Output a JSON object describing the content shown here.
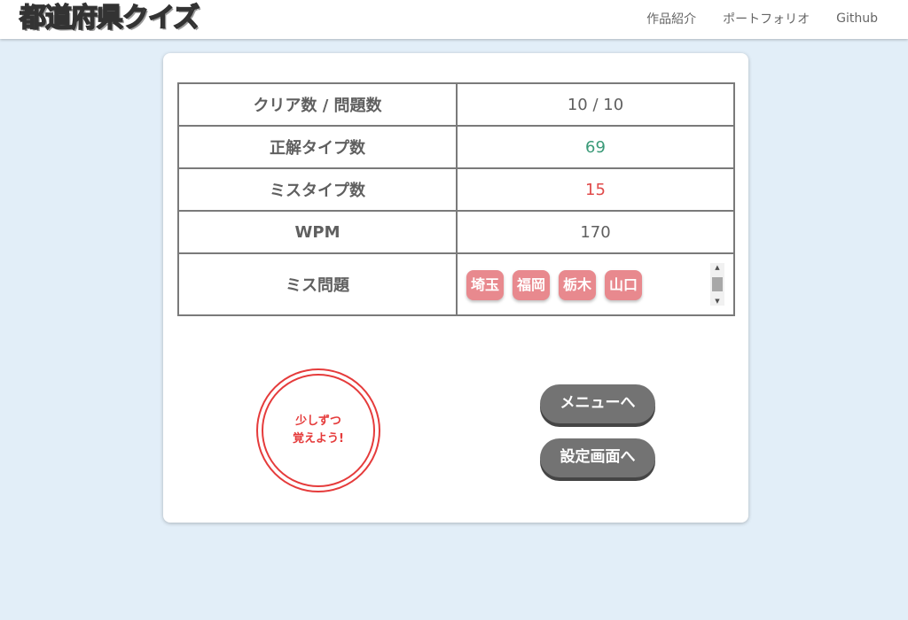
{
  "header": {
    "logo_prefix": "都",
    "logo_accent": "道",
    "logo_suffix": "府県クイズ",
    "nav": [
      "作品紹介",
      "ポートフォリオ",
      "Github"
    ]
  },
  "result_table": {
    "rows": [
      {
        "label": "クリア数 / 問題数",
        "value": "10 / 10"
      },
      {
        "label": "正解タイプ数",
        "value": "69"
      },
      {
        "label": "ミスタイプ数",
        "value": "15"
      },
      {
        "label": "WPM",
        "value": "170"
      }
    ],
    "miss_label": "ミス問題",
    "miss_items": [
      "埼玉",
      "福岡",
      "栃木",
      "山口"
    ]
  },
  "stamp": {
    "line1": "少しずつ",
    "line2": "覚えよう!"
  },
  "buttons": {
    "menu": "メニューへ",
    "settings": "設定画面へ"
  },
  "colors": {
    "background": "#e2eef8",
    "correct": "#3a9a78",
    "miss": "#e04a4a",
    "chip": "#e8898e",
    "button": "#737373",
    "logo_accent": "#f2b63c"
  }
}
